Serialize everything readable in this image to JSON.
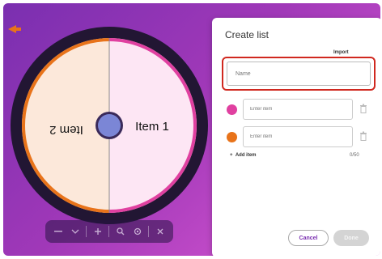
{
  "wheel": {
    "segments": [
      {
        "label": "Item 1",
        "fill": "#fde6f4",
        "edge": "#e040a0"
      },
      {
        "label": "Item 2",
        "fill": "#fce8da",
        "edge": "#e8731a"
      }
    ],
    "rim_color": "#221633",
    "hub_color": "#7b86d6",
    "pointer_color": "#e8731a"
  },
  "toolbar": {
    "icons": [
      "minimize-icon",
      "chevron-down-icon",
      "add-icon",
      "zoom-icon",
      "settings-icon",
      "close-icon"
    ]
  },
  "panel": {
    "title": "Create list",
    "import_label": "Import",
    "name_placeholder": "Name",
    "items": [
      {
        "placeholder": "Enter item",
        "color": "#e040a0"
      },
      {
        "placeholder": "Enter item",
        "color": "#e8731a"
      }
    ],
    "add_item_label": "Add item",
    "count_label": "0/50",
    "cancel_label": "Cancel",
    "done_label": "Done"
  },
  "colors": {
    "accent": "#7a2fb0",
    "highlight_border": "#d0281f"
  }
}
